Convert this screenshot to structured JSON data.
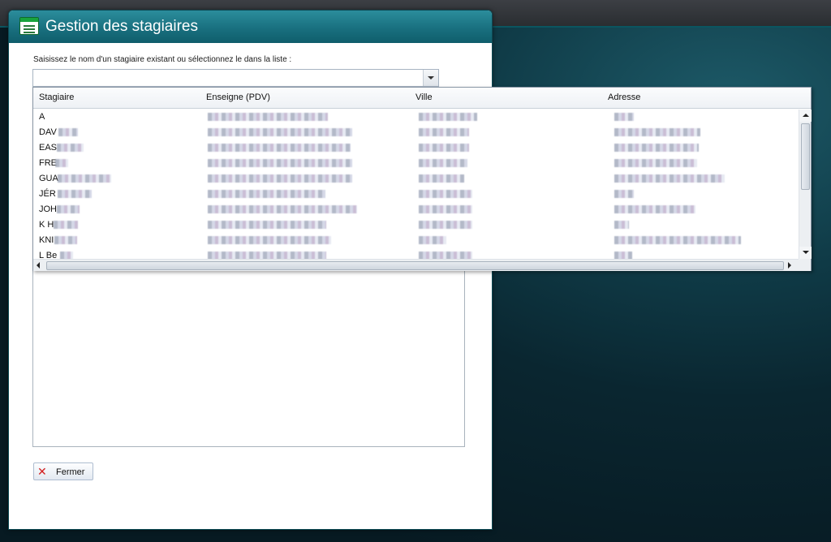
{
  "window": {
    "title": "Gestion des stagiaires",
    "prompt": "Saisissez le nom d'un stagiaire existant ou sélectionnez le dans la liste :",
    "search_value": "",
    "close_label": "Fermer",
    "icons": {
      "app": "spreadsheet-form-icon",
      "close": "red-x-icon"
    }
  },
  "dropdown": {
    "columns": [
      "Stagiaire",
      "Enseigne (PDV)",
      "Ville",
      "Adresse"
    ],
    "rows": [
      {
        "stagiaire": "A"
      },
      {
        "stagiaire": "DAV"
      },
      {
        "stagiaire": "EAS"
      },
      {
        "stagiaire": "FRE"
      },
      {
        "stagiaire": "GUA"
      },
      {
        "stagiaire": "JÉR"
      },
      {
        "stagiaire": "JOH"
      },
      {
        "stagiaire": "K H"
      },
      {
        "stagiaire": "KNI"
      },
      {
        "stagiaire": "L Be"
      }
    ]
  },
  "colors": {
    "titlebar": "#19707f",
    "close_icon": "#d21e1e"
  }
}
